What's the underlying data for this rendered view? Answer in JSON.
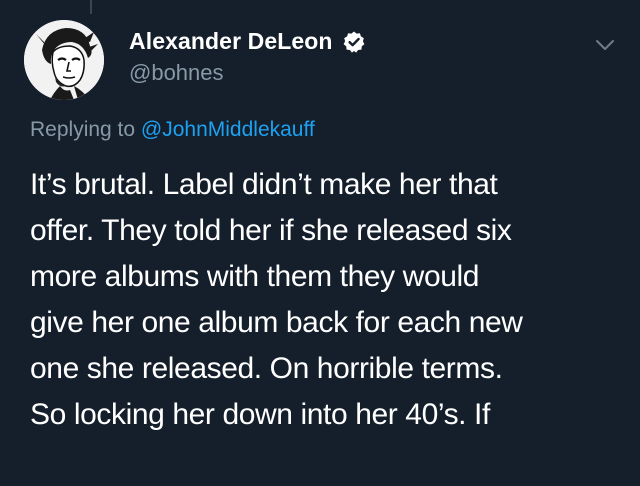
{
  "author": {
    "display_name": "Alexander DeLeon",
    "handle": "@bohnes",
    "avatar_icon": "portrait-avatar",
    "verified_icon": "verified-badge-icon"
  },
  "reply": {
    "prefix": "Replying to",
    "user": "@JohnMiddlekauff"
  },
  "tweet": {
    "lines": [
      "It’s brutal. Label didn’t make her that",
      "offer. They told her if she released six",
      "more albums with them they would",
      "give her one album back for each new",
      "one she released. On horrible terms.",
      "So locking her down into her 40’s. If"
    ]
  },
  "colors": {
    "background": "#151f2b",
    "text_primary": "#ffffff",
    "text_secondary": "#8899a6",
    "link": "#1da1f2"
  }
}
